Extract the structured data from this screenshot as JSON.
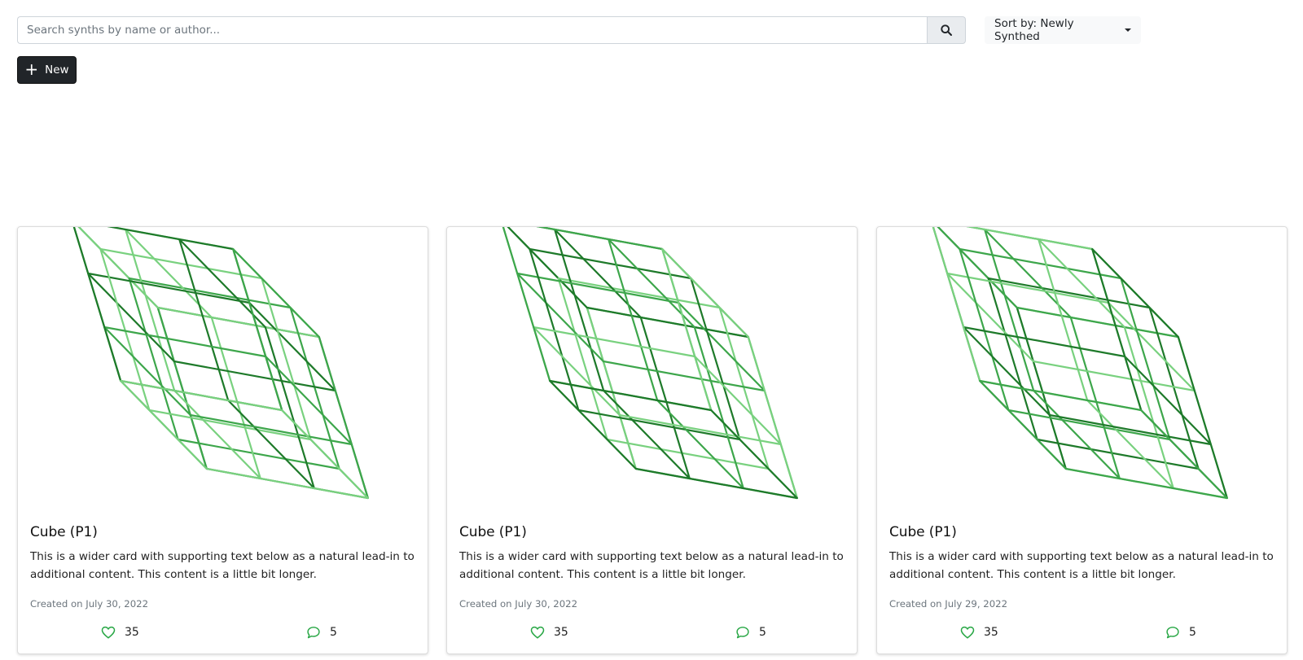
{
  "search": {
    "placeholder": "Search synths by name or author...",
    "value": ""
  },
  "sort": {
    "label": "Sort by: Newly Synthed"
  },
  "new_button": {
    "label": "New",
    "icon": "plus-icon"
  },
  "colors": {
    "accent_green": "#28a745",
    "dark_button": "#212529",
    "wire_dark": "#1e7a2a",
    "wire_mid": "#3da64b",
    "wire_light": "#79d17f"
  },
  "cards": [
    {
      "title": "Cube (P1)",
      "description": "This is a wider card with supporting text below as a natural lead-in to additional content. This content is a little bit longer.",
      "created": "Created on July 30, 2022",
      "likes": "35",
      "comments": "5"
    },
    {
      "title": "Cube (P1)",
      "description": "This is a wider card with supporting text below as a natural lead-in to additional content. This content is a little bit longer.",
      "created": "Created on July 30, 2022",
      "likes": "35",
      "comments": "5"
    },
    {
      "title": "Cube (P1)",
      "description": "This is a wider card with supporting text below as a natural lead-in to additional content. This content is a little bit longer.",
      "created": "Created on July 29, 2022",
      "likes": "35",
      "comments": "5"
    }
  ]
}
